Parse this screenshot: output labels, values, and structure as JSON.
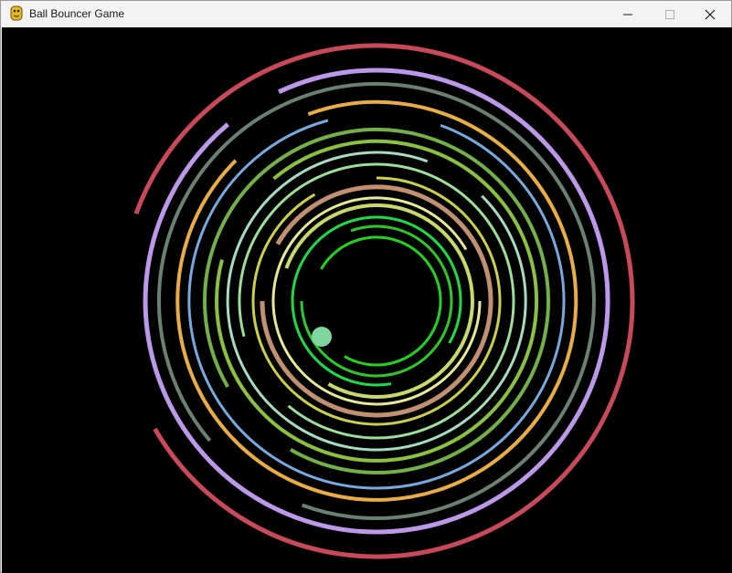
{
  "window": {
    "title": "Ball Bouncer Game",
    "icon": "python-icon"
  },
  "controls": {
    "minimize_icon": "minimize-icon",
    "maximize_icon": "maximize-icon",
    "close_icon": "close-icon"
  },
  "game": {
    "background": "#000000",
    "ball_color": "#7fd6a0",
    "ring_colors": [
      "#22d222",
      "#2fc72a",
      "#1ed94a",
      "#c9d86a",
      "#e8e89a",
      "#c09070",
      "#cbcf4a",
      "#9edd9a",
      "#a8dcc0",
      "#8cc040",
      "#73b04a",
      "#78a8dc",
      "#e8ad45",
      "#6a8070",
      "#bc98e8",
      "#c84a5a"
    ]
  }
}
